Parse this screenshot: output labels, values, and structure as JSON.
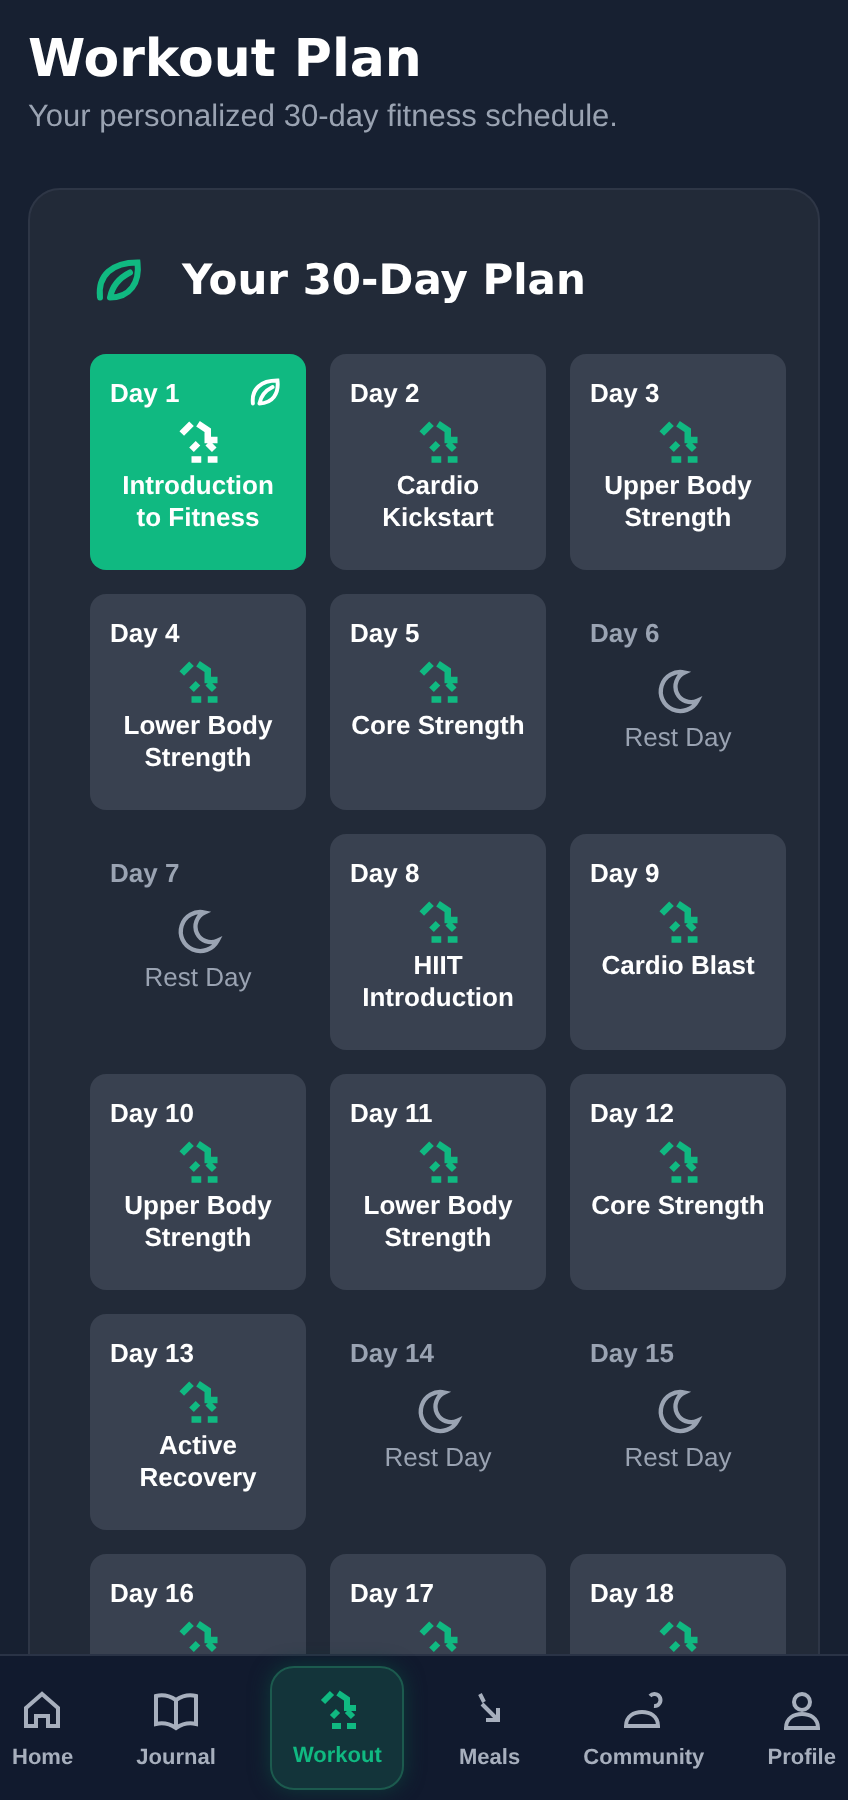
{
  "header": {
    "title": "Workout Plan",
    "subtitle": "Your personalized 30-day fitness schedule."
  },
  "plan": {
    "title": "Your 30-Day Plan",
    "days": [
      {
        "label": "Day 1",
        "title": "Introduction to Fitness",
        "kind": "workout",
        "selected": true
      },
      {
        "label": "Day 2",
        "title": "Cardio Kickstart",
        "kind": "workout",
        "selected": false
      },
      {
        "label": "Day 3",
        "title": "Upper Body Strength",
        "kind": "workout",
        "selected": false
      },
      {
        "label": "Day 4",
        "title": "Lower Body Strength",
        "kind": "workout",
        "selected": false
      },
      {
        "label": "Day 5",
        "title": "Core Strength",
        "kind": "workout",
        "selected": false
      },
      {
        "label": "Day 6",
        "title": "Rest Day",
        "kind": "rest",
        "selected": false
      },
      {
        "label": "Day 7",
        "title": "Rest Day",
        "kind": "rest",
        "selected": false
      },
      {
        "label": "Day 8",
        "title": "HIIT Introduction",
        "kind": "workout",
        "selected": false
      },
      {
        "label": "Day 9",
        "title": "Cardio Blast",
        "kind": "workout",
        "selected": false
      },
      {
        "label": "Day 10",
        "title": "Upper Body Strength",
        "kind": "workout",
        "selected": false
      },
      {
        "label": "Day 11",
        "title": "Lower Body Strength",
        "kind": "workout",
        "selected": false
      },
      {
        "label": "Day 12",
        "title": "Core Strength",
        "kind": "workout",
        "selected": false
      },
      {
        "label": "Day 13",
        "title": "Active Recovery",
        "kind": "workout",
        "selected": false
      },
      {
        "label": "Day 14",
        "title": "Rest Day",
        "kind": "rest",
        "selected": false
      },
      {
        "label": "Day 15",
        "title": "Rest Day",
        "kind": "rest",
        "selected": false
      },
      {
        "label": "Day 16",
        "kind": "workout",
        "selected": false
      },
      {
        "label": "Day 17",
        "kind": "workout",
        "selected": false
      },
      {
        "label": "Day 18",
        "kind": "workout",
        "selected": false
      }
    ]
  },
  "nav": [
    {
      "label": "Home",
      "selected": false
    },
    {
      "label": "Journal",
      "selected": false
    },
    {
      "label": "Workout",
      "selected": true
    },
    {
      "label": "Meals",
      "selected": false
    },
    {
      "label": "Community",
      "selected": false
    },
    {
      "label": "Profile",
      "selected": false
    }
  ]
}
